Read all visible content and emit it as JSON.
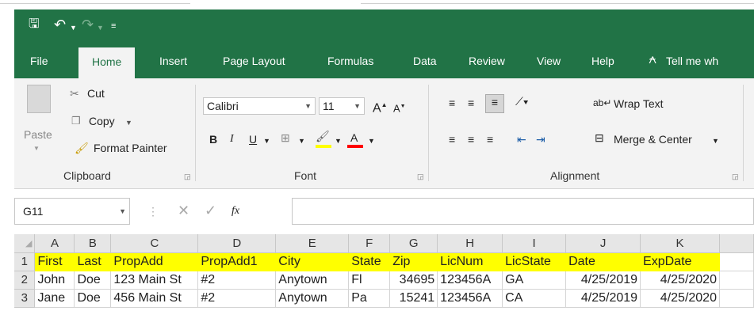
{
  "quick_access": {
    "save_icon": "save-icon",
    "undo_icon": "undo-icon",
    "redo_icon": "redo-icon",
    "customize_icon": "customize-icon"
  },
  "tabs": [
    "File",
    "Home",
    "Insert",
    "Page Layout",
    "Formulas",
    "Data",
    "Review",
    "View",
    "Help"
  ],
  "tell_me": "Tell me wh",
  "clipboard": {
    "paste": "Paste",
    "cut": "Cut",
    "copy": "Copy",
    "format_painter": "Format Painter",
    "group": "Clipboard"
  },
  "font": {
    "name": "Calibri",
    "size": "11",
    "bold": "B",
    "italic": "I",
    "underline": "U",
    "font_color_letter": "A",
    "group": "Font",
    "fill_color": "#ffff00",
    "font_color": "#ff0000"
  },
  "alignment": {
    "wrap_text": "Wrap Text",
    "merge_center": "Merge & Center",
    "group": "Alignment"
  },
  "formula_bar": {
    "name_box": "G11",
    "fx": "fx",
    "content": ""
  },
  "grid": {
    "columns": [
      "A",
      "B",
      "C",
      "D",
      "E",
      "F",
      "G",
      "H",
      "I",
      "J",
      "K"
    ],
    "rows": [
      {
        "num": "1",
        "cells": [
          "First",
          "Last",
          "PropAdd",
          "PropAdd1",
          "City",
          "State",
          "Zip",
          "LicNum",
          "LicState",
          "Date",
          "ExpDate"
        ]
      },
      {
        "num": "2",
        "cells": [
          "John",
          "Doe",
          "123 Main St",
          "#2",
          "Anytown",
          "Fl",
          "34695",
          "123456A",
          "GA",
          "4/25/2019",
          "4/25/2020"
        ]
      },
      {
        "num": "3",
        "cells": [
          "Jane",
          "Doe",
          "456 Main St",
          "#2",
          "Anytown",
          "Pa",
          "15241",
          "123456A",
          "CA",
          "4/25/2019",
          "4/25/2020"
        ]
      }
    ],
    "highlight_color": "#ffff00"
  }
}
